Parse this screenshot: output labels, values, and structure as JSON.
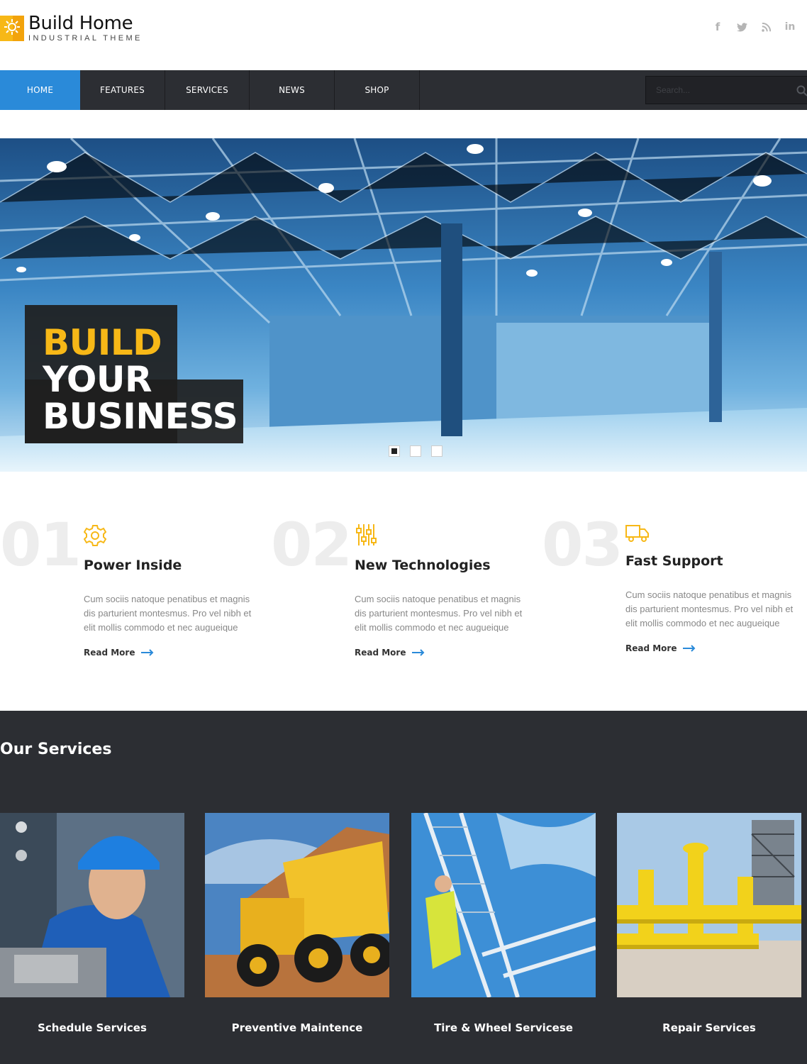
{
  "brand": {
    "name": "Build Home",
    "tagline": "INDUSTRIAL THEME",
    "accent": "#f7b817"
  },
  "social": [
    {
      "name": "facebook-icon",
      "glyph": "f"
    },
    {
      "name": "twitter-icon",
      "glyph": "t"
    },
    {
      "name": "rss-icon",
      "glyph": "r"
    },
    {
      "name": "linkedin-icon",
      "glyph": "in"
    }
  ],
  "nav": {
    "items": [
      {
        "label": "HOME",
        "active": true
      },
      {
        "label": "FEATURES",
        "active": false
      },
      {
        "label": "SERVICES",
        "active": false
      },
      {
        "label": "NEWS",
        "active": false
      },
      {
        "label": "SHOP",
        "active": false
      }
    ],
    "search_placeholder": "Search...",
    "active_color": "#2a8ad9"
  },
  "hero": {
    "line1": "BUILD",
    "line2": "YOUR",
    "line3": "BUSINESS",
    "slides": 3,
    "active_slide": 1
  },
  "features": [
    {
      "num": "01",
      "icon": "gear-icon",
      "title": "Power Inside",
      "text": "Cum sociis natoque penatibus et magnis dis parturient montesmus. Pro vel nibh et elit mollis commodo et nec augueique",
      "link": "Read More"
    },
    {
      "num": "02",
      "icon": "sliders-icon",
      "title": "New Technologies",
      "text": "Cum sociis natoque penatibus et magnis dis parturient montesmus. Pro vel nibh et elit mollis commodo et nec augueique",
      "link": "Read More"
    },
    {
      "num": "03",
      "icon": "truck-icon",
      "title": "Fast Support",
      "text": "Cum sociis natoque penatibus et magnis dis parturient montesmus. Pro vel nibh et elit mollis commodo et nec augueique",
      "link": "Read More"
    }
  ],
  "services": {
    "title": "Our Services",
    "items": [
      {
        "label": "Schedule Services",
        "image": "worker-photo"
      },
      {
        "label": "Preventive Maintence",
        "image": "dump-truck-photo"
      },
      {
        "label": "Tire & Wheel Servicese",
        "image": "refinery-photo"
      },
      {
        "label": "Repair Services",
        "image": "pipeline-photo"
      }
    ]
  }
}
